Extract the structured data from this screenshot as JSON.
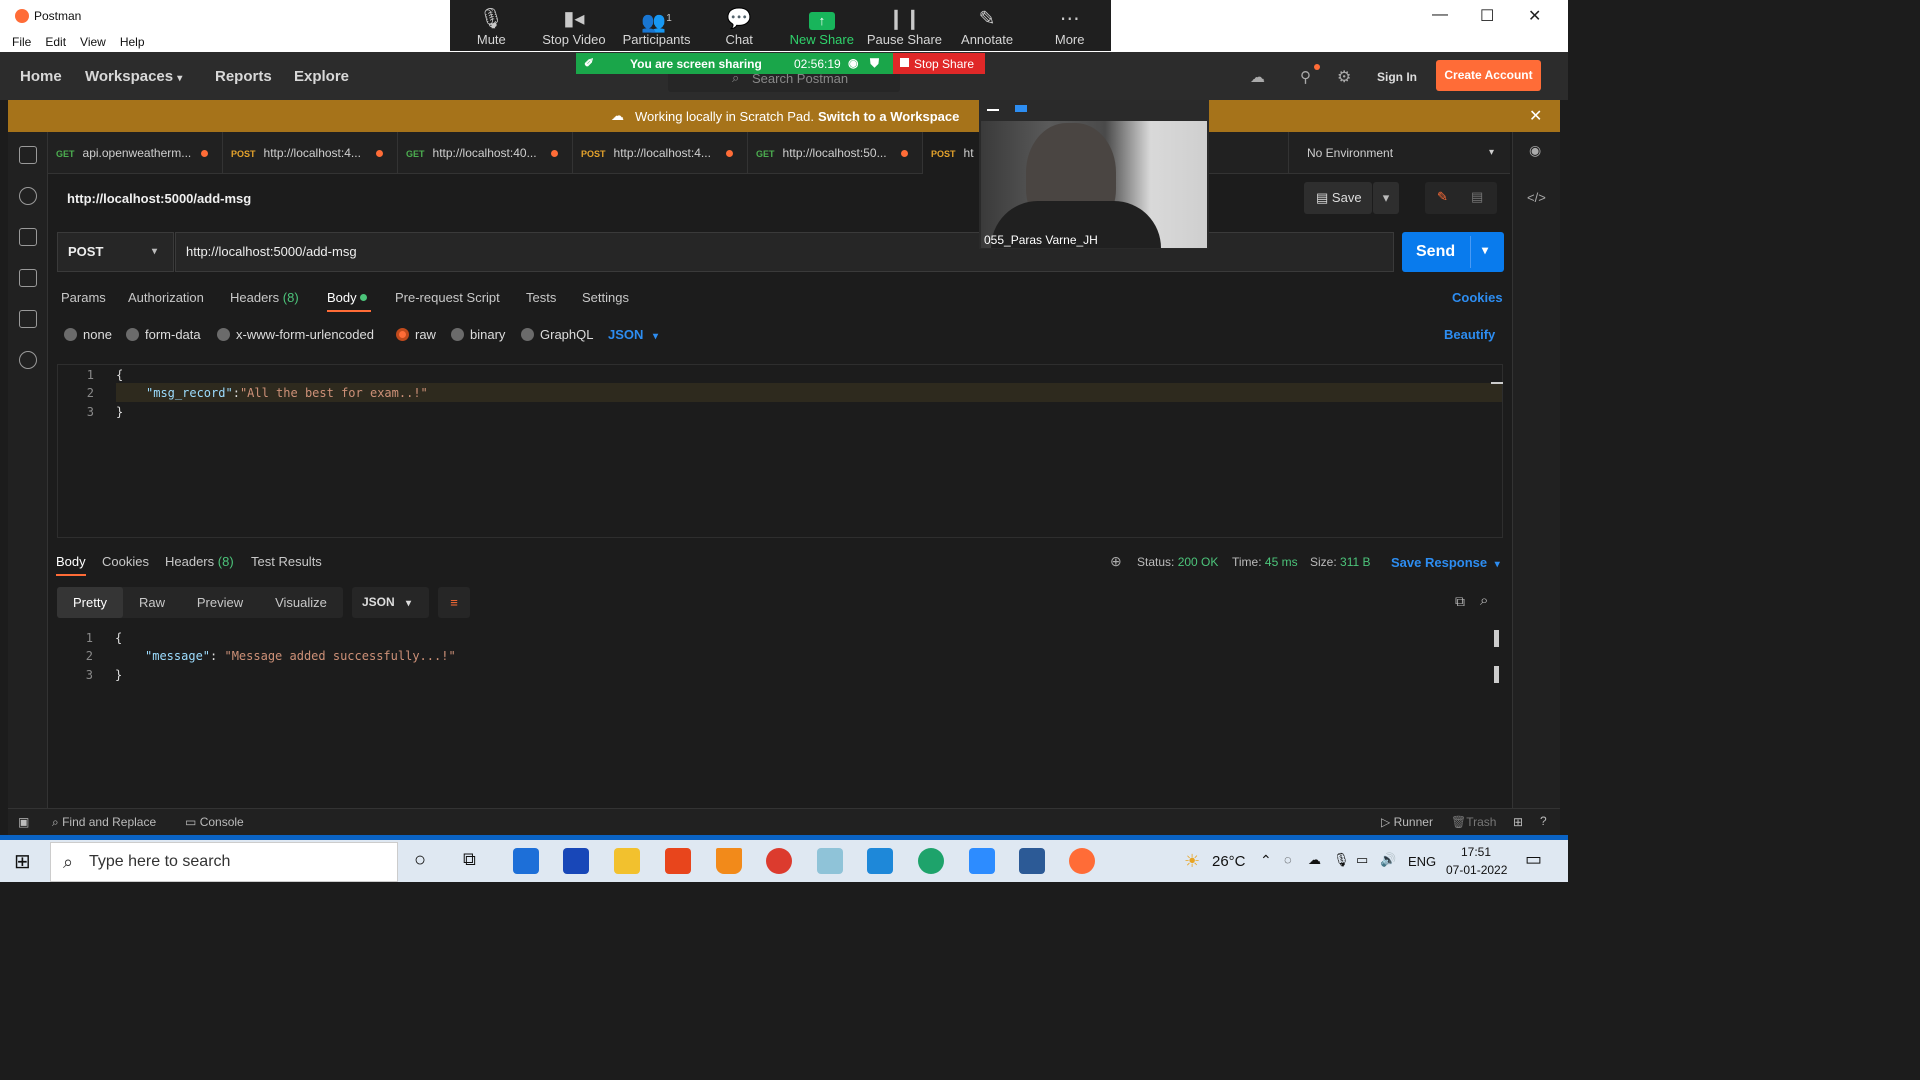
{
  "window": {
    "title": "Postman",
    "menus": [
      "File",
      "Edit",
      "View",
      "Help"
    ],
    "controls": [
      "—",
      "☐",
      "✕"
    ]
  },
  "zoom": {
    "items": [
      {
        "label": "Mute",
        "icon": "microphone-icon"
      },
      {
        "label": "Stop Video",
        "icon": "video-camera-icon"
      },
      {
        "label": "Participants",
        "icon": "participants-icon",
        "badge": "1"
      },
      {
        "label": "Chat",
        "icon": "chat-icon"
      },
      {
        "label": "New Share",
        "icon": "share-screen-icon"
      },
      {
        "label": "Pause Share",
        "icon": "pause-icon"
      },
      {
        "label": "Annotate",
        "icon": "pencil-icon"
      },
      {
        "label": "More",
        "icon": "more-dots-icon"
      }
    ],
    "sharing_text": "You are screen sharing",
    "timer": "02:56:19",
    "stop_share": "Stop Share",
    "accent": "#1aa64a"
  },
  "nav": {
    "home": "Home",
    "workspaces": "Workspaces",
    "reports": "Reports",
    "explore": "Explore",
    "search_placeholder": "Search Postman",
    "sign_in": "Sign In",
    "create_account": "Create Account"
  },
  "banner": {
    "text": "Working locally in Scratch Pad.",
    "link": "Switch to a Workspace"
  },
  "tabs": [
    {
      "method": "GET",
      "label": "api.openweatherm..."
    },
    {
      "method": "POST",
      "label": "http://localhost:4..."
    },
    {
      "method": "GET",
      "label": "http://localhost:40..."
    },
    {
      "method": "POST",
      "label": "http://localhost:4..."
    },
    {
      "method": "GET",
      "label": "http://localhost:50..."
    },
    {
      "method": "POST",
      "label": "ht"
    }
  ],
  "environment": "No Environment",
  "request": {
    "title": "http://localhost:5000/add-msg",
    "method": "POST",
    "url": "http://localhost:5000/add-msg",
    "save": "Save",
    "send": "Send",
    "tabs": {
      "params": "Params",
      "authorization": "Authorization",
      "headers": "Headers",
      "headers_count": "(8)",
      "body": "Body",
      "prerequest": "Pre-request Script",
      "tests": "Tests",
      "settings": "Settings"
    },
    "cookies": "Cookies",
    "body_types": [
      "none",
      "form-data",
      "x-www-form-urlencoded",
      "raw",
      "binary",
      "GraphQL"
    ],
    "selected_body_type": "raw",
    "format": "JSON",
    "beautify": "Beautify",
    "code": {
      "open": "{",
      "key": "\"msg_record\"",
      "sep": ":",
      "value": "\"All the best for exam..!\"",
      "close": "}"
    }
  },
  "response": {
    "tabs": {
      "body": "Body",
      "cookies": "Cookies",
      "headers": "Headers",
      "headers_count": "(8)",
      "tests": "Test Results"
    },
    "status_label": "Status:",
    "status": "200 OK",
    "time_label": "Time:",
    "time": "45 ms",
    "size_label": "Size:",
    "size": "311 B",
    "save_response": "Save Response",
    "views": [
      "Pretty",
      "Raw",
      "Preview",
      "Visualize"
    ],
    "format": "JSON",
    "code": {
      "open": "{",
      "key": "\"message\"",
      "sep": ": ",
      "value": "\"Message added successfully...!\"",
      "close": "}"
    }
  },
  "video": {
    "name": "055_Paras Varne_JH"
  },
  "statusbar": {
    "find_replace": "Find and Replace",
    "console": "Console",
    "runner": "Runner",
    "trash": "Trash"
  },
  "taskbar": {
    "search_placeholder": "Type here to search",
    "temperature": "26°C",
    "language": "ENG",
    "time": "17:51",
    "date": "07-01-2022"
  }
}
